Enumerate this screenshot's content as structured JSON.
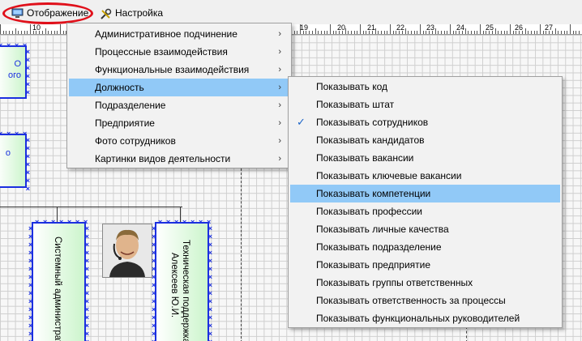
{
  "menubar": {
    "view_label": "Отображение",
    "settings_label": "Настройка",
    "highlight_color": "#e0101a"
  },
  "ruler": {
    "labels": [
      "10",
      "19",
      "20",
      "21",
      "22",
      "23",
      "24",
      "25",
      "26",
      "27"
    ]
  },
  "canvas": {
    "left_node_1_lines": [
      "О",
      "ого"
    ],
    "left_node_2_lines": [
      "о"
    ],
    "node_sysadmin_text": "Системный администрато",
    "node_support_line1": "Техническая поддержка",
    "node_support_line2": "Алексеев Ю.И.",
    "node_gradient_colors": [
      "#ffffff",
      "#ccf5cc"
    ],
    "node_border_color": "#1b2fe0"
  },
  "main_menu": {
    "items": [
      {
        "label": "Административное подчинение",
        "has_submenu": true
      },
      {
        "label": "Процессные взаимодействия",
        "has_submenu": true
      },
      {
        "label": "Функциональные взаимодействия",
        "has_submenu": true
      },
      {
        "label": "Должность",
        "has_submenu": true,
        "highlighted": true
      },
      {
        "label": "Подразделение",
        "has_submenu": true
      },
      {
        "label": "Предприятие",
        "has_submenu": true
      },
      {
        "label": "Фото сотрудников",
        "has_submenu": true
      },
      {
        "label": "Картинки видов деятельности",
        "has_submenu": true
      }
    ],
    "highlight_color": "#91c9f7"
  },
  "sub_menu": {
    "items": [
      {
        "label": "Показывать код"
      },
      {
        "label": "Показывать штат"
      },
      {
        "label": "Показывать сотрудников",
        "checked": true
      },
      {
        "label": "Показывать кандидатов"
      },
      {
        "label": "Показывать вакансии"
      },
      {
        "label": "Показывать ключевые вакансии"
      },
      {
        "label": "Показывать компетенции",
        "highlighted": true
      },
      {
        "label": "Показывать профессии"
      },
      {
        "label": "Показывать личные качества"
      },
      {
        "label": "Показывать подразделение"
      },
      {
        "label": "Показывать предприятие"
      },
      {
        "label": "Показывать группы ответственных"
      },
      {
        "label": "Показывать ответственность за процессы"
      },
      {
        "label": "Показывать функциональных руководителей"
      }
    ],
    "check_color": "#1a64c8"
  }
}
